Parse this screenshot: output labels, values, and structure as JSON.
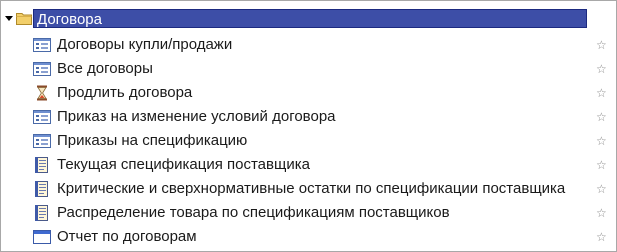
{
  "tree": {
    "root": {
      "label": "Договора",
      "icon": "folder-icon",
      "expanded": true
    },
    "items": [
      {
        "label": "Договоры купли/продажи",
        "icon": "list-form-icon",
        "favorite_glyph": "☆"
      },
      {
        "label": "Все договоры",
        "icon": "list-form-icon",
        "favorite_glyph": "☆"
      },
      {
        "label": "Продлить договора",
        "icon": "hourglass-icon",
        "favorite_glyph": "☆"
      },
      {
        "label": "Приказ на изменение условий договора",
        "icon": "list-form-icon",
        "favorite_glyph": "☆"
      },
      {
        "label": "Приказы на спецификацию",
        "icon": "list-form-icon",
        "favorite_glyph": "☆"
      },
      {
        "label": "Текущая спецификация поставщика",
        "icon": "report-icon",
        "favorite_glyph": "☆"
      },
      {
        "label": "Критические и сверхнормативные остатки по спецификации поставщика",
        "icon": "report-icon",
        "favorite_glyph": "☆"
      },
      {
        "label": "Распределение товара по спецификациям поставщиков",
        "icon": "report-icon",
        "favorite_glyph": "☆"
      },
      {
        "label": "Отчет по договорам",
        "icon": "window-icon",
        "favorite_glyph": "☆"
      }
    ]
  },
  "colors": {
    "selection": "#3d4ea7",
    "star": "#8a8a8a"
  }
}
